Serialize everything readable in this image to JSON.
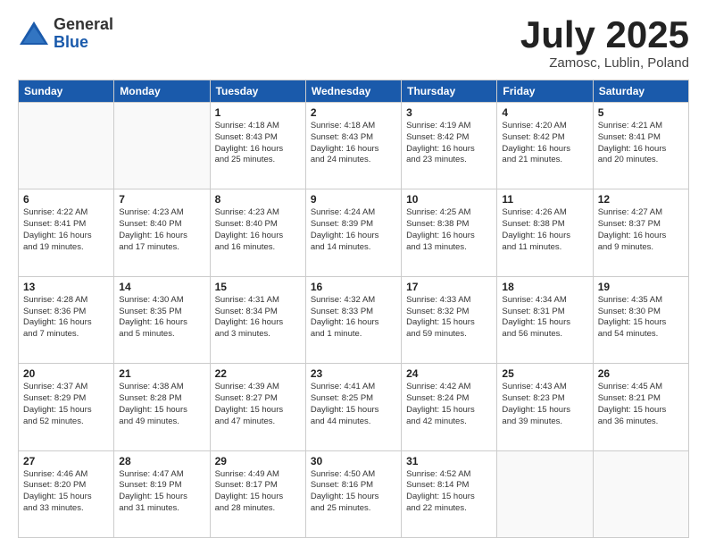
{
  "logo": {
    "general": "General",
    "blue": "Blue"
  },
  "title": "July 2025",
  "location": "Zamosc, Lublin, Poland",
  "headers": [
    "Sunday",
    "Monday",
    "Tuesday",
    "Wednesday",
    "Thursday",
    "Friday",
    "Saturday"
  ],
  "weeks": [
    [
      {
        "day": "",
        "info": ""
      },
      {
        "day": "",
        "info": ""
      },
      {
        "day": "1",
        "info": "Sunrise: 4:18 AM\nSunset: 8:43 PM\nDaylight: 16 hours\nand 25 minutes."
      },
      {
        "day": "2",
        "info": "Sunrise: 4:18 AM\nSunset: 8:43 PM\nDaylight: 16 hours\nand 24 minutes."
      },
      {
        "day": "3",
        "info": "Sunrise: 4:19 AM\nSunset: 8:42 PM\nDaylight: 16 hours\nand 23 minutes."
      },
      {
        "day": "4",
        "info": "Sunrise: 4:20 AM\nSunset: 8:42 PM\nDaylight: 16 hours\nand 21 minutes."
      },
      {
        "day": "5",
        "info": "Sunrise: 4:21 AM\nSunset: 8:41 PM\nDaylight: 16 hours\nand 20 minutes."
      }
    ],
    [
      {
        "day": "6",
        "info": "Sunrise: 4:22 AM\nSunset: 8:41 PM\nDaylight: 16 hours\nand 19 minutes."
      },
      {
        "day": "7",
        "info": "Sunrise: 4:23 AM\nSunset: 8:40 PM\nDaylight: 16 hours\nand 17 minutes."
      },
      {
        "day": "8",
        "info": "Sunrise: 4:23 AM\nSunset: 8:40 PM\nDaylight: 16 hours\nand 16 minutes."
      },
      {
        "day": "9",
        "info": "Sunrise: 4:24 AM\nSunset: 8:39 PM\nDaylight: 16 hours\nand 14 minutes."
      },
      {
        "day": "10",
        "info": "Sunrise: 4:25 AM\nSunset: 8:38 PM\nDaylight: 16 hours\nand 13 minutes."
      },
      {
        "day": "11",
        "info": "Sunrise: 4:26 AM\nSunset: 8:38 PM\nDaylight: 16 hours\nand 11 minutes."
      },
      {
        "day": "12",
        "info": "Sunrise: 4:27 AM\nSunset: 8:37 PM\nDaylight: 16 hours\nand 9 minutes."
      }
    ],
    [
      {
        "day": "13",
        "info": "Sunrise: 4:28 AM\nSunset: 8:36 PM\nDaylight: 16 hours\nand 7 minutes."
      },
      {
        "day": "14",
        "info": "Sunrise: 4:30 AM\nSunset: 8:35 PM\nDaylight: 16 hours\nand 5 minutes."
      },
      {
        "day": "15",
        "info": "Sunrise: 4:31 AM\nSunset: 8:34 PM\nDaylight: 16 hours\nand 3 minutes."
      },
      {
        "day": "16",
        "info": "Sunrise: 4:32 AM\nSunset: 8:33 PM\nDaylight: 16 hours\nand 1 minute."
      },
      {
        "day": "17",
        "info": "Sunrise: 4:33 AM\nSunset: 8:32 PM\nDaylight: 15 hours\nand 59 minutes."
      },
      {
        "day": "18",
        "info": "Sunrise: 4:34 AM\nSunset: 8:31 PM\nDaylight: 15 hours\nand 56 minutes."
      },
      {
        "day": "19",
        "info": "Sunrise: 4:35 AM\nSunset: 8:30 PM\nDaylight: 15 hours\nand 54 minutes."
      }
    ],
    [
      {
        "day": "20",
        "info": "Sunrise: 4:37 AM\nSunset: 8:29 PM\nDaylight: 15 hours\nand 52 minutes."
      },
      {
        "day": "21",
        "info": "Sunrise: 4:38 AM\nSunset: 8:28 PM\nDaylight: 15 hours\nand 49 minutes."
      },
      {
        "day": "22",
        "info": "Sunrise: 4:39 AM\nSunset: 8:27 PM\nDaylight: 15 hours\nand 47 minutes."
      },
      {
        "day": "23",
        "info": "Sunrise: 4:41 AM\nSunset: 8:25 PM\nDaylight: 15 hours\nand 44 minutes."
      },
      {
        "day": "24",
        "info": "Sunrise: 4:42 AM\nSunset: 8:24 PM\nDaylight: 15 hours\nand 42 minutes."
      },
      {
        "day": "25",
        "info": "Sunrise: 4:43 AM\nSunset: 8:23 PM\nDaylight: 15 hours\nand 39 minutes."
      },
      {
        "day": "26",
        "info": "Sunrise: 4:45 AM\nSunset: 8:21 PM\nDaylight: 15 hours\nand 36 minutes."
      }
    ],
    [
      {
        "day": "27",
        "info": "Sunrise: 4:46 AM\nSunset: 8:20 PM\nDaylight: 15 hours\nand 33 minutes."
      },
      {
        "day": "28",
        "info": "Sunrise: 4:47 AM\nSunset: 8:19 PM\nDaylight: 15 hours\nand 31 minutes."
      },
      {
        "day": "29",
        "info": "Sunrise: 4:49 AM\nSunset: 8:17 PM\nDaylight: 15 hours\nand 28 minutes."
      },
      {
        "day": "30",
        "info": "Sunrise: 4:50 AM\nSunset: 8:16 PM\nDaylight: 15 hours\nand 25 minutes."
      },
      {
        "day": "31",
        "info": "Sunrise: 4:52 AM\nSunset: 8:14 PM\nDaylight: 15 hours\nand 22 minutes."
      },
      {
        "day": "",
        "info": ""
      },
      {
        "day": "",
        "info": ""
      }
    ]
  ]
}
